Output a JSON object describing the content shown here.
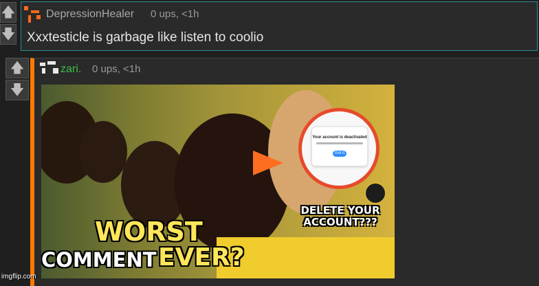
{
  "comment1": {
    "username": "DepressionHealer",
    "meta": "0 ups, <1h",
    "text": "Xxxtesticle is garbage like listen to coolio",
    "upvote_icon": "arrow-up",
    "downvote_icon": "arrow-down"
  },
  "comment2": {
    "username": "zari.",
    "meta": "0 ups, <1h",
    "upvote_icon": "arrow-up",
    "downvote_icon": "arrow-down"
  },
  "meme": {
    "popup_title": "Your account is deactivated",
    "popup_button": "Got it",
    "top_caption": "DELETE YOUR ACCOUNT???",
    "bottom_caption_1": "WORST",
    "bottom_caption_2": "COMMENT",
    "bottom_caption_3": "EVER?",
    "watermark": "imgflip.com"
  },
  "colors": {
    "background": "#1f1f1f",
    "panel": "#2a2a2a",
    "border": "#2f8c97",
    "accent": "#ff7a00",
    "username_green": "#39c04a"
  }
}
